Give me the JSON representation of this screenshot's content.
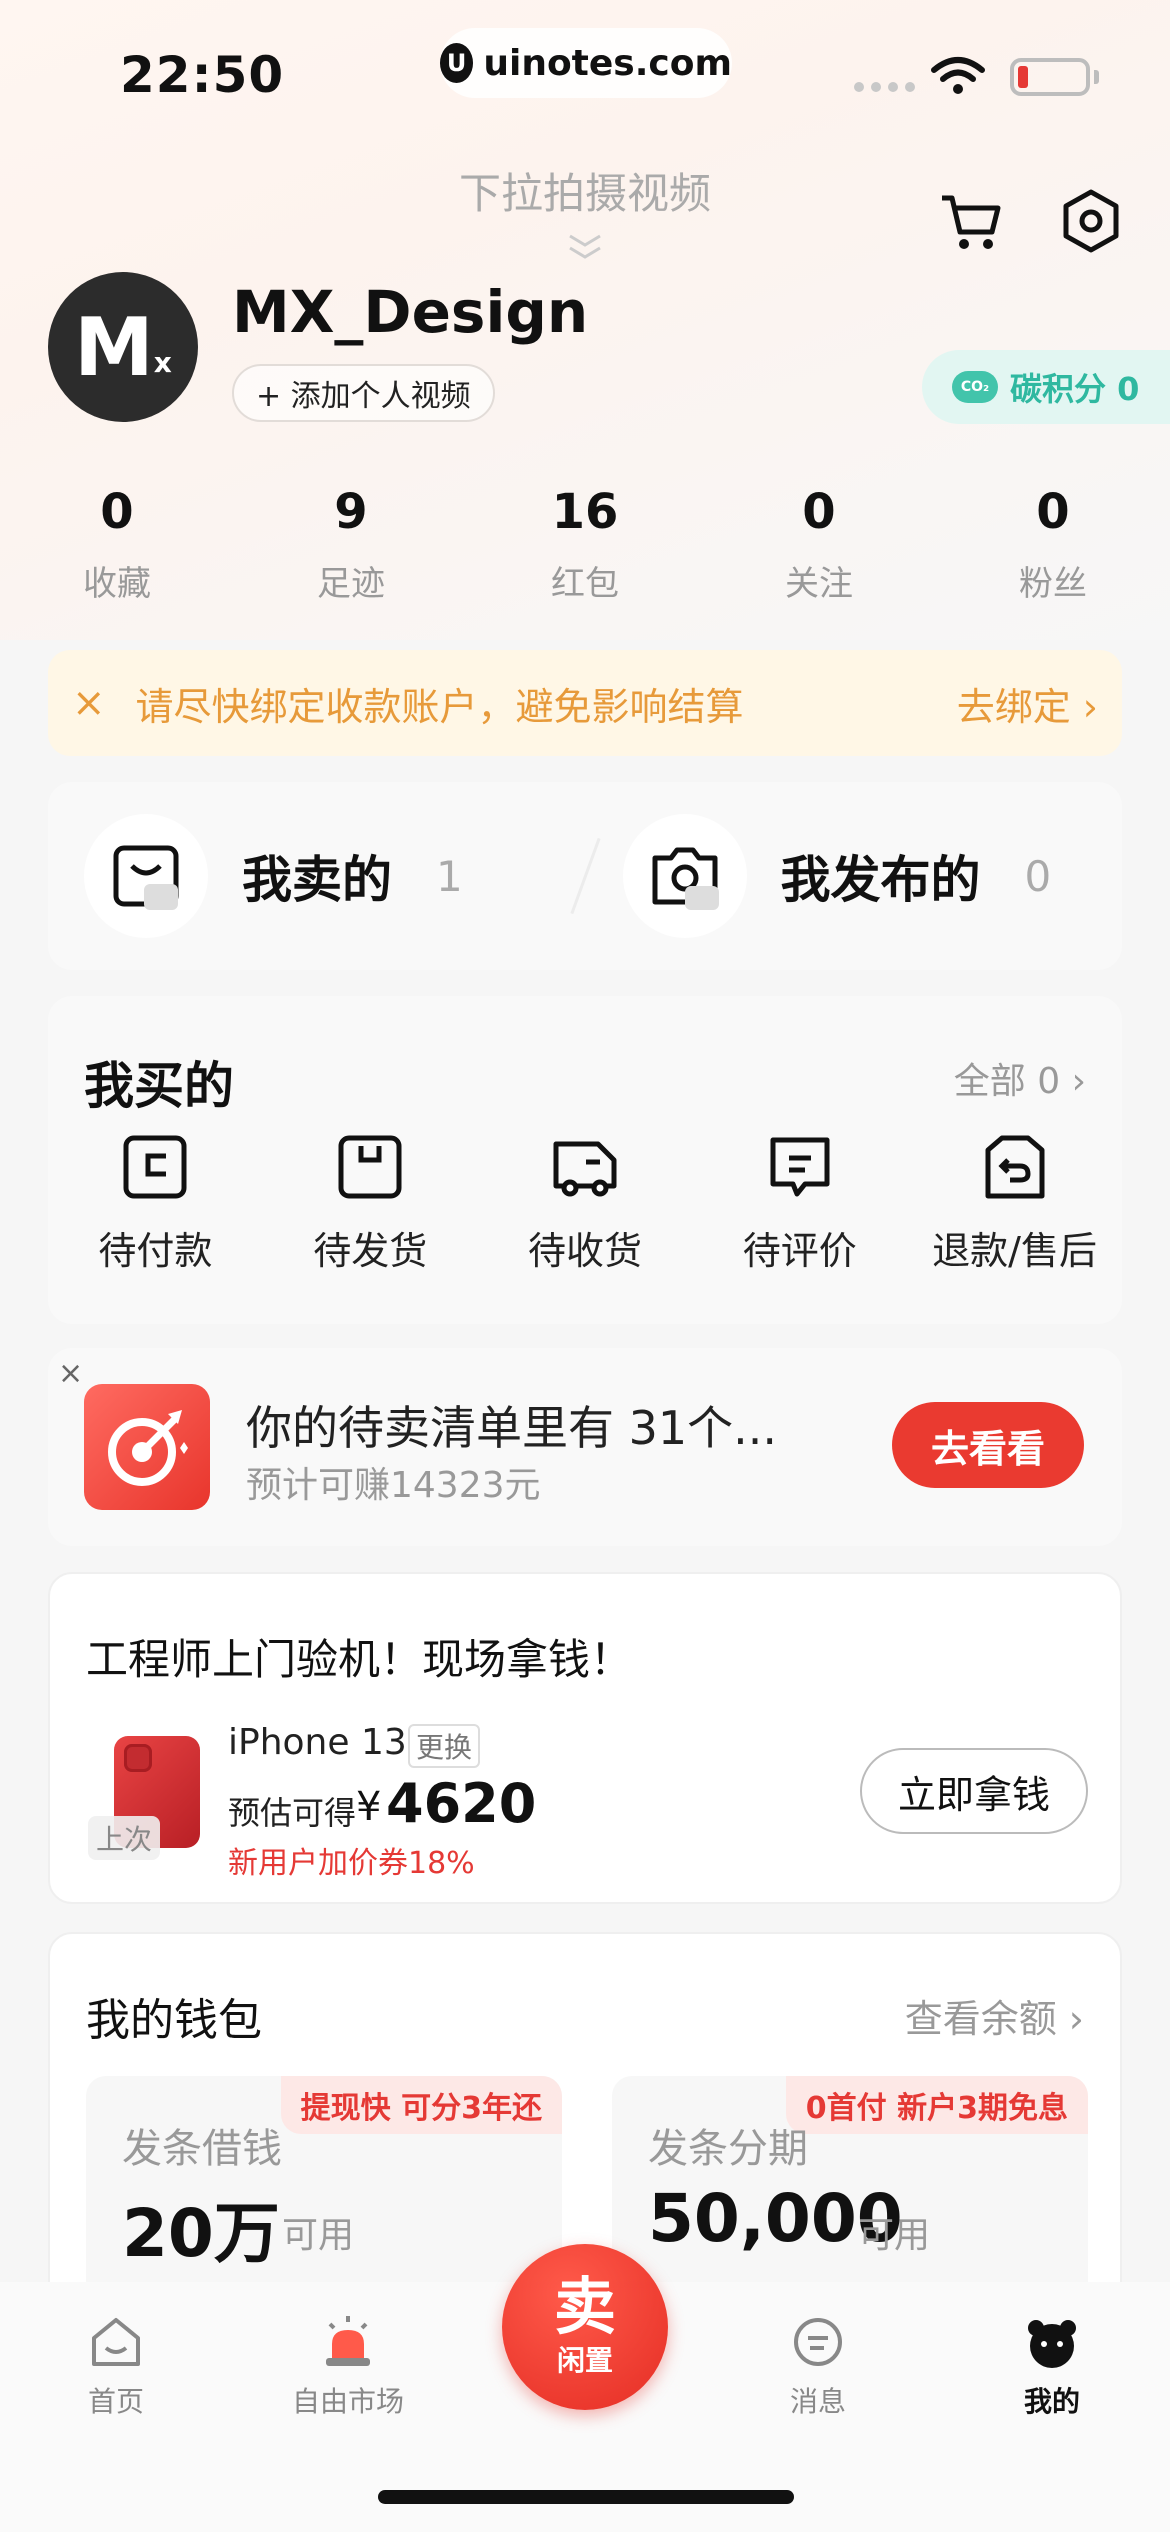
{
  "status_bar": {
    "time": "22:50",
    "url": "uinotes.com"
  },
  "header": {
    "pull_hint": "下拉拍摄视频"
  },
  "profile": {
    "avatar_text": "M",
    "avatar_sub": "x",
    "username": "MX_Design",
    "add_video": "+ 添加个人视频",
    "carbon": "碳积分 0",
    "carbon_badge": "CO₂"
  },
  "stats": [
    {
      "num": "0",
      "label": "收藏"
    },
    {
      "num": "9",
      "label": "足迹"
    },
    {
      "num": "16",
      "label": "红包"
    },
    {
      "num": "0",
      "label": "关注"
    },
    {
      "num": "0",
      "label": "粉丝"
    }
  ],
  "notice": {
    "close": "×",
    "message": "请尽快绑定收款账户，避免影响结算",
    "action": "去绑定 ›"
  },
  "sell_publish": {
    "sold_label": "我卖的",
    "sold_count": "1",
    "published_label": "我发布的",
    "published_count": "0"
  },
  "bought": {
    "title": "我买的",
    "all": "全部 0 ›",
    "items": [
      "待付款",
      "待发货",
      "待收货",
      "待评价",
      "退款/售后"
    ]
  },
  "pending": {
    "close": "×",
    "title": "你的待卖清单里有 31个...",
    "subtitle": "预计可赚14323元",
    "button": "去看看"
  },
  "engineer": {
    "title": "工程师上门验机！现场拿钱！",
    "last_tag": "上次",
    "model": "iPhone 13",
    "change": "更换",
    "estimate_label": "预估可得",
    "currency": "¥",
    "estimate_value": "4620",
    "coupon": "新用户加价券18%",
    "button": "立即拿钱"
  },
  "wallet": {
    "title": "我的钱包",
    "more": "查看余额 ›",
    "left": {
      "tag": "提现快 可分3年还",
      "name": "发条借钱",
      "amount": "20万",
      "unit": "可用"
    },
    "right": {
      "tag": "0首付 新户3期免息",
      "name": "发条分期",
      "amount": "50,000",
      "unit": "可用"
    }
  },
  "tabbar": {
    "home": "首页",
    "market": "自由市场",
    "sell_big": "卖",
    "sell_small": "闲置",
    "messages": "消息",
    "mine": "我的"
  },
  "colors": {
    "accent": "#ea3a30",
    "notice": "#e79a3a",
    "carbon": "#2fb8a0"
  }
}
